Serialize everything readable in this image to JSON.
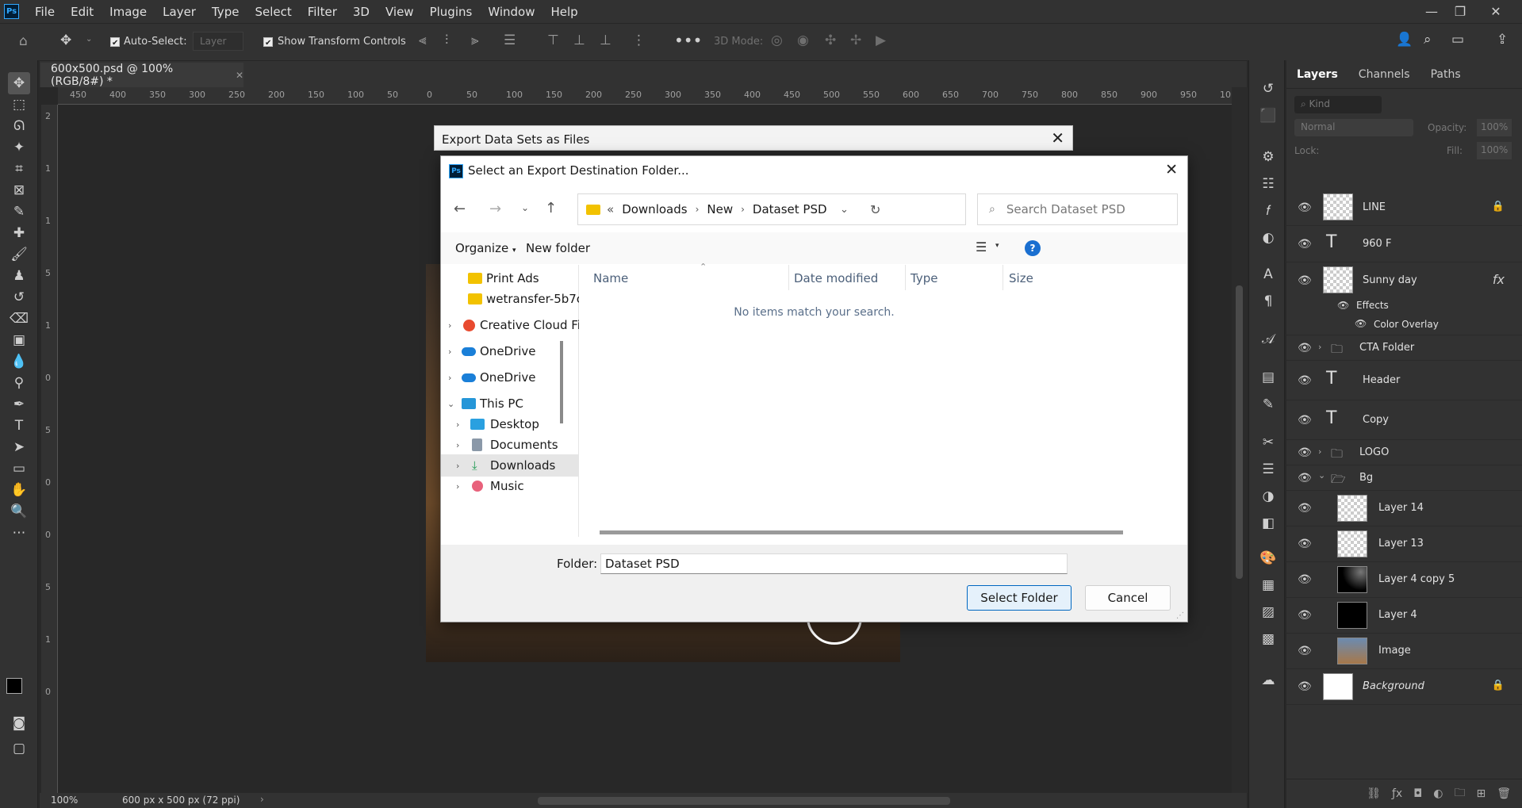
{
  "app": {
    "menu": [
      "File",
      "Edit",
      "Image",
      "Layer",
      "Type",
      "Select",
      "Filter",
      "3D",
      "View",
      "Plugins",
      "Window",
      "Help"
    ],
    "logo": "Ps"
  },
  "options": {
    "auto_select": "Auto-Select:",
    "layer_select": "Layer",
    "show_transform": "Show Transform Controls",
    "mode_3d": "3D Mode:"
  },
  "document": {
    "tab": "600x500.psd @ 100% (RGB/8#) *",
    "zoom": "100%",
    "info": "600 px x 500 px (72 ppi)"
  },
  "ruler": {
    "h": [
      "450",
      "400",
      "350",
      "300",
      "250",
      "200",
      "150",
      "100",
      "50",
      "0",
      "50",
      "100",
      "150",
      "200",
      "250",
      "300",
      "350",
      "400",
      "450",
      "500",
      "550",
      "600",
      "650",
      "700",
      "750",
      "800",
      "850",
      "900",
      "950",
      "10"
    ],
    "v": [
      "2",
      "1",
      "1",
      "5",
      "1",
      "0",
      "5",
      "0",
      "0",
      "5",
      "1",
      "0"
    ]
  },
  "outer_dialog": {
    "title": "Export Data Sets as Files"
  },
  "dialog": {
    "title": "Select an Export Destination Folder...",
    "path": [
      "Downloads",
      "New",
      "Dataset PSD"
    ],
    "search_placeholder": "Search Dataset PSD",
    "organize": "Organize",
    "new_folder": "New folder",
    "nav": [
      {
        "label": "Print Ads",
        "icon": "folder-icon"
      },
      {
        "label": "wetransfer-5b7c",
        "icon": "folder-icon"
      },
      {
        "label": "Creative Cloud Fil",
        "icon": "creative-cloud-icon"
      },
      {
        "label": "OneDrive",
        "icon": "cloud-icon"
      },
      {
        "label": "OneDrive",
        "icon": "cloud-icon"
      },
      {
        "label": "This PC",
        "icon": "computer-icon"
      },
      {
        "label": "Desktop",
        "icon": "desktop-icon"
      },
      {
        "label": "Documents",
        "icon": "documents-icon"
      },
      {
        "label": "Downloads",
        "icon": "download-icon"
      },
      {
        "label": "Music",
        "icon": "music-icon"
      }
    ],
    "columns": [
      "Name",
      "Date modified",
      "Type",
      "Size"
    ],
    "empty": "No items match your search.",
    "folder_label": "Folder:",
    "folder_value": "Dataset PSD",
    "select_btn": "Select Folder",
    "cancel_btn": "Cancel"
  },
  "panel": {
    "tabs": [
      "Layers",
      "Channels",
      "Paths"
    ],
    "kind": "Kind",
    "blend": "Normal",
    "opacity_label": "Opacity:",
    "opacity": "100%",
    "lock_label": "Lock:",
    "fill_label": "Fill:",
    "fill": "100%",
    "layers": [
      {
        "name": "LINE",
        "type": "raster"
      },
      {
        "name": "960 F",
        "type": "text"
      },
      {
        "name": "Sunny day",
        "type": "smart",
        "fx": "fx"
      },
      {
        "name": "Effects",
        "type": "effect"
      },
      {
        "name": "Color Overlay",
        "type": "effect"
      },
      {
        "name": "CTA Folder",
        "type": "group"
      },
      {
        "name": "Header",
        "type": "text"
      },
      {
        "name": "Copy",
        "type": "text"
      },
      {
        "name": "LOGO",
        "type": "group"
      },
      {
        "name": "Bg",
        "type": "group"
      },
      {
        "name": "Layer 14",
        "type": "raster"
      },
      {
        "name": "Layer 13",
        "type": "raster"
      },
      {
        "name": "Layer 4 copy 5",
        "type": "raster"
      },
      {
        "name": "Layer 4",
        "type": "raster"
      },
      {
        "name": "Image",
        "type": "raster"
      },
      {
        "name": "Background",
        "type": "raster"
      }
    ]
  }
}
